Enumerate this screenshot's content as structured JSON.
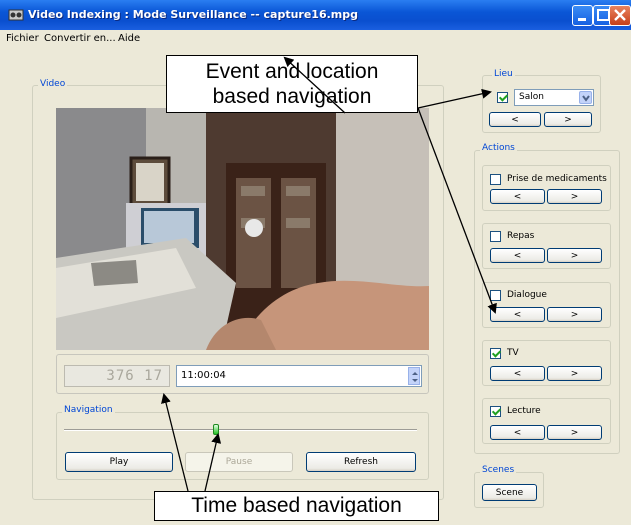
{
  "window": {
    "title": "Video Indexing : Mode Surveillance -- capture16.mpg"
  },
  "menu": {
    "items": [
      "Fichier",
      "Convertir en...",
      "Aide"
    ]
  },
  "video_group": {
    "label": "Video"
  },
  "time_panel": {
    "counter": "376 17",
    "time_value": "11:00:04"
  },
  "navigation": {
    "label": "Navigation",
    "slider_position_fraction": 0.43,
    "play_label": "Play",
    "pause_label": "Pause",
    "refresh_label": "Refresh"
  },
  "lieu": {
    "label": "Lieu",
    "selected": "Salon",
    "checked": true,
    "prev": "<",
    "next": ">"
  },
  "actions": {
    "label": "Actions",
    "items": [
      {
        "label": "Prise de medicaments",
        "checked": false,
        "prev": "<",
        "next": ">"
      },
      {
        "label": "Repas",
        "checked": false,
        "prev": "<",
        "next": ">"
      },
      {
        "label": "Dialogue",
        "checked": false,
        "prev": "<",
        "next": ">"
      },
      {
        "label": "TV",
        "checked": true,
        "prev": "<",
        "next": ">"
      },
      {
        "label": "Lecture",
        "checked": true,
        "prev": "<",
        "next": ">"
      }
    ]
  },
  "scenes": {
    "label": "Scenes",
    "button": "Scene"
  },
  "annotations": {
    "top_line1": "Event and location",
    "top_line2": "based navigation",
    "bottom": "Time based navigation"
  },
  "colors": {
    "title_blue": "#0a56d6",
    "group_label": "#0046d5",
    "window_bg": "#ece9d8"
  }
}
